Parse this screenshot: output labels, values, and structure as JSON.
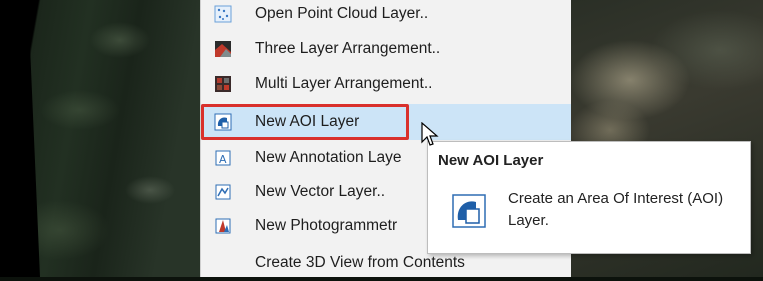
{
  "menu": {
    "items": [
      {
        "label": "Open Point Cloud Layer..",
        "icon": "point-cloud-icon"
      },
      {
        "label": "Three Layer Arrangement..",
        "icon": "three-layer-icon"
      },
      {
        "label": "Multi Layer Arrangement..",
        "icon": "multi-layer-icon"
      },
      {
        "label": "New AOI Layer",
        "icon": "aoi-layer-icon"
      },
      {
        "label": "New Annotation Laye",
        "icon": "annotation-layer-icon"
      },
      {
        "label": "New Vector Layer..",
        "icon": "vector-layer-icon"
      },
      {
        "label": "New Photogrammetr",
        "icon": "photogrammetry-icon"
      },
      {
        "label": "Create 3D View from Contents",
        "icon": ""
      }
    ]
  },
  "tooltip": {
    "title": "New AOI Layer",
    "description": "Create an Area Of Interest (AOI) Layer.",
    "icon": "aoi-layer-icon"
  },
  "colors": {
    "menu_bg": "#f2f2f2",
    "hover_bg": "#cce4f7",
    "highlight_border": "#d9302c"
  }
}
